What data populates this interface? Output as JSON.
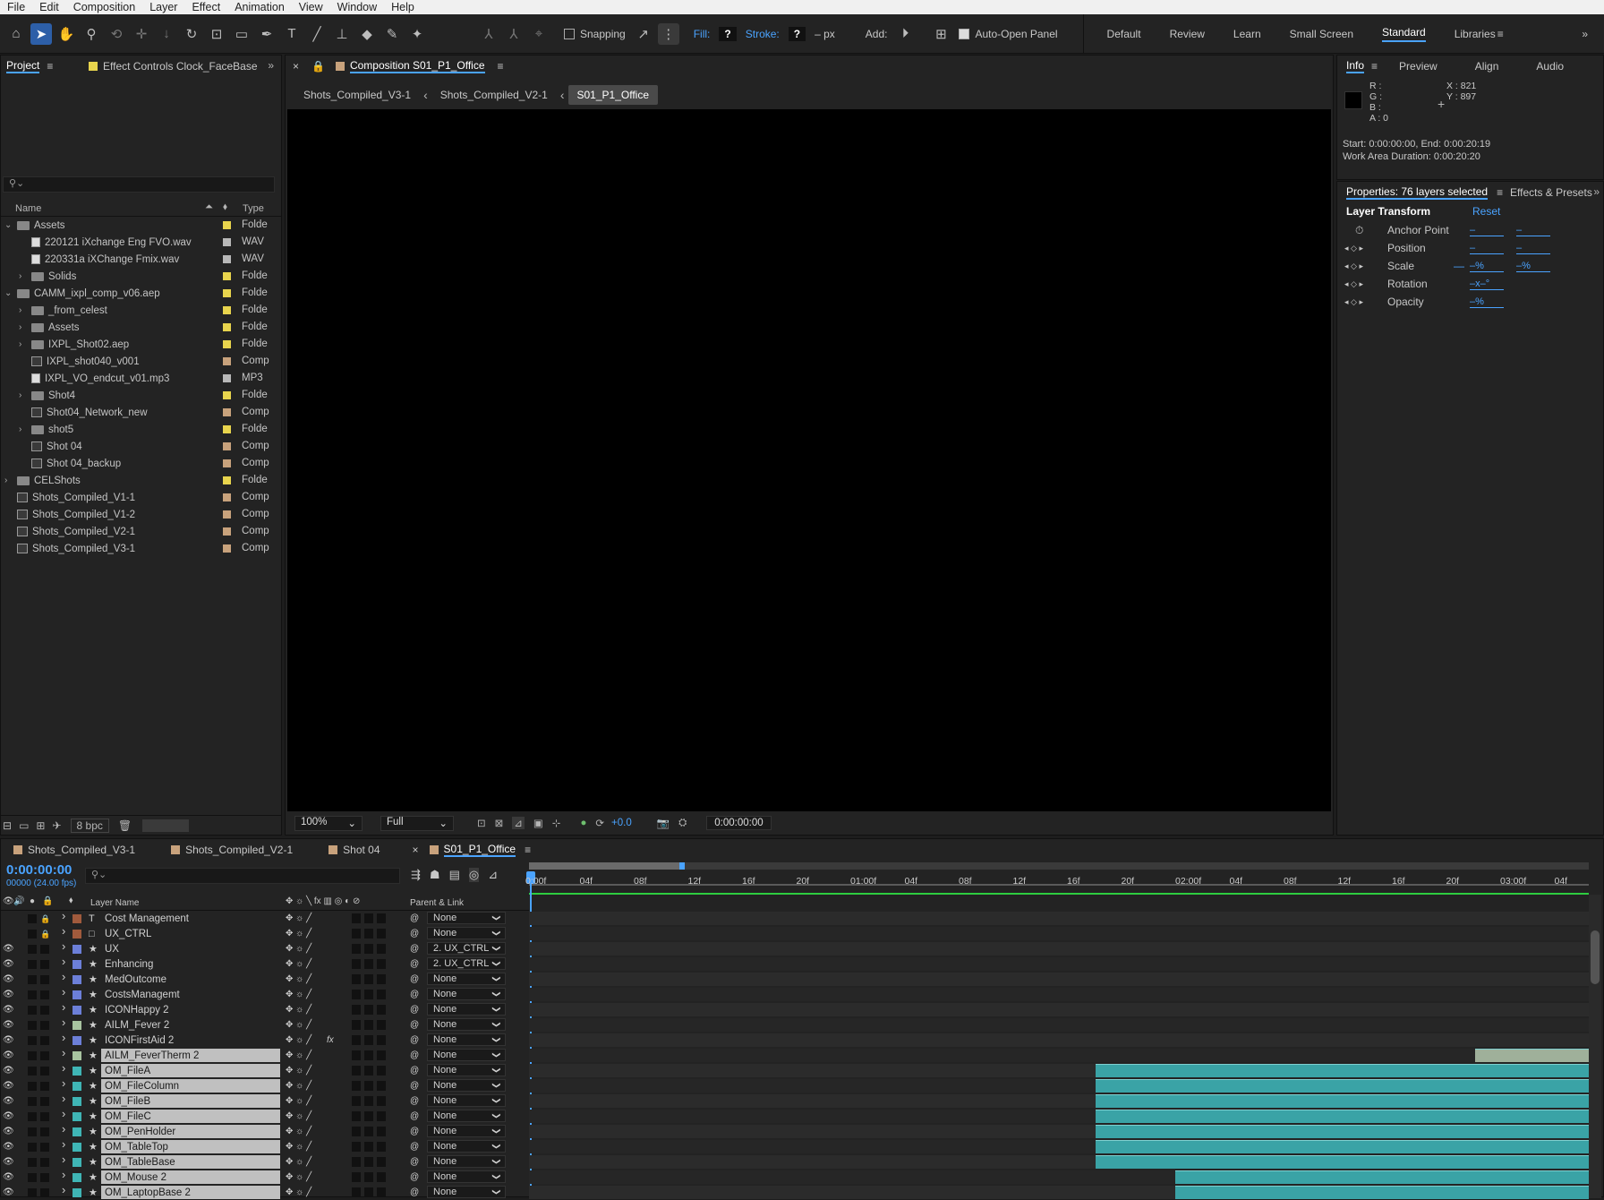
{
  "menu": [
    "File",
    "Edit",
    "Composition",
    "Layer",
    "Effect",
    "Animation",
    "View",
    "Window",
    "Help"
  ],
  "toolbar": {
    "snapping": "Snapping",
    "fill": "Fill:",
    "fill_value": "?",
    "stroke": "Stroke:",
    "stroke_value": "?",
    "stroke_px": "– px",
    "add": "Add:",
    "auto_open": "Auto-Open Panel"
  },
  "workspaces": [
    "Default",
    "Review",
    "Learn",
    "Small Screen",
    "Standard",
    "Libraries"
  ],
  "workspace_current": "Standard",
  "project": {
    "tab": "Project",
    "effect_tab": "Effect Controls Clock_FaceBase",
    "col_name": "Name",
    "col_type": "Type",
    "bpc": "8 bpc",
    "items": [
      {
        "name": "Assets",
        "type": "Folde",
        "kind": "folder",
        "indent": 0,
        "open": true,
        "color": "#e8d44d"
      },
      {
        "name": "220121 iXchange Eng FVO.wav",
        "type": "WAV",
        "kind": "audio",
        "indent": 1,
        "color": "#b8b8b8"
      },
      {
        "name": "220331a iXChange Fmix.wav",
        "type": "WAV",
        "kind": "audio",
        "indent": 1,
        "color": "#b8b8b8"
      },
      {
        "name": "Solids",
        "type": "Folde",
        "kind": "folder",
        "indent": 1,
        "closed": true,
        "color": "#e8d44d"
      },
      {
        "name": "CAMM_ixpl_comp_v06.aep",
        "type": "Folde",
        "kind": "folder",
        "indent": 0,
        "open": true,
        "color": "#e8d44d"
      },
      {
        "name": "_from_celest",
        "type": "Folde",
        "kind": "folder",
        "indent": 1,
        "closed": true,
        "color": "#e8d44d"
      },
      {
        "name": "Assets",
        "type": "Folde",
        "kind": "folder",
        "indent": 1,
        "closed": true,
        "color": "#e8d44d"
      },
      {
        "name": "IXPL_Shot02.aep",
        "type": "Folde",
        "kind": "folder",
        "indent": 1,
        "closed": true,
        "color": "#e8d44d"
      },
      {
        "name": "IXPL_shot040_v001",
        "type": "Comp",
        "kind": "comp",
        "indent": 1,
        "color": "#c8a27c"
      },
      {
        "name": "IXPL_VO_endcut_v01.mp3",
        "type": "MP3",
        "kind": "audio",
        "indent": 1,
        "color": "#b8b8b8"
      },
      {
        "name": "Shot4",
        "type": "Folde",
        "kind": "folder",
        "indent": 1,
        "closed": true,
        "color": "#e8d44d"
      },
      {
        "name": "Shot04_Network_new",
        "type": "Comp",
        "kind": "comp",
        "indent": 1,
        "color": "#c8a27c"
      },
      {
        "name": "shot5",
        "type": "Folde",
        "kind": "folder",
        "indent": 1,
        "closed": true,
        "color": "#e8d44d"
      },
      {
        "name": "Shot 04",
        "type": "Comp",
        "kind": "comp",
        "indent": 1,
        "color": "#c8a27c"
      },
      {
        "name": "Shot 04_backup",
        "type": "Comp",
        "kind": "comp",
        "indent": 1,
        "color": "#c8a27c"
      },
      {
        "name": "CELShots",
        "type": "Folde",
        "kind": "folder",
        "indent": 0,
        "closed": true,
        "color": "#e8d44d"
      },
      {
        "name": "Shots_Compiled_V1-1",
        "type": "Comp",
        "kind": "comp",
        "indent": 0,
        "color": "#c8a27c"
      },
      {
        "name": "Shots_Compiled_V1-2",
        "type": "Comp",
        "kind": "comp",
        "indent": 0,
        "color": "#c8a27c"
      },
      {
        "name": "Shots_Compiled_V2-1",
        "type": "Comp",
        "kind": "comp",
        "indent": 0,
        "color": "#c8a27c"
      },
      {
        "name": "Shots_Compiled_V3-1",
        "type": "Comp",
        "kind": "comp",
        "indent": 0,
        "color": "#c8a27c"
      }
    ]
  },
  "composition": {
    "tab": "Composition S01_P1_Office",
    "breadcrumbs": [
      "Shots_Compiled_V3-1",
      "Shots_Compiled_V2-1",
      "S01_P1_Office"
    ],
    "zoom": "100%",
    "resolution": "Full",
    "exposure": "+0.0",
    "timecode": "0:00:00:00"
  },
  "info": {
    "tabs": [
      "Info",
      "Preview",
      "Align",
      "Audio"
    ],
    "r": "R :",
    "g": "G :",
    "b": "B :",
    "a": "A :  0",
    "x": "X : 821",
    "y": "Y : 897",
    "start": "Start: 0:00:00:00, End: 0:00:20:19",
    "duration": "Work Area Duration: 0:00:20:20"
  },
  "properties": {
    "tab": "Properties: 76 layers selected",
    "effects_tab": "Effects & Presets",
    "section": "Layer Transform",
    "reset": "Reset",
    "rows": [
      {
        "label": "Anchor Point",
        "v1": "–",
        "v2": "–"
      },
      {
        "label": "Position",
        "v1": "–",
        "v2": "–"
      },
      {
        "label": "Scale",
        "v1": "–%",
        "v2": "–%"
      },
      {
        "label": "Rotation",
        "v1": "–x–°",
        "v2": ""
      },
      {
        "label": "Opacity",
        "v1": "–%",
        "v2": ""
      }
    ]
  },
  "timeline": {
    "tabs": [
      "Shots_Compiled_V3-1",
      "Shots_Compiled_V2-1",
      "Shot 04",
      "S01_P1_Office"
    ],
    "timecode": "0:00:00:00",
    "fps": "00000 (24.00 fps)",
    "col_layer": "Layer Name",
    "col_parent": "Parent & Link",
    "ticks": [
      "0:00f",
      "04f",
      "08f",
      "12f",
      "16f",
      "20f",
      "01:00f",
      "04f",
      "08f",
      "12f",
      "16f",
      "20f",
      "02:00f",
      "04f",
      "08f",
      "12f",
      "16f",
      "20f",
      "03:00f",
      "04f"
    ],
    "layers": [
      {
        "name": "Cost Management",
        "type": "T",
        "color": "#a05a3c",
        "parent": "None",
        "lock": true,
        "eye": false,
        "sel": false
      },
      {
        "name": "UX_CTRL",
        "type": "□",
        "color": "#a05a3c",
        "parent": "None",
        "lock": true,
        "eye": false,
        "sel": false
      },
      {
        "name": "UX",
        "type": "★",
        "color": "#6c7fd8",
        "parent": "2. UX_CTRL",
        "eye": true,
        "sel": false
      },
      {
        "name": "Enhancing",
        "type": "★",
        "color": "#6c7fd8",
        "parent": "2. UX_CTRL",
        "eye": true,
        "sel": false
      },
      {
        "name": "MedOutcome",
        "type": "★",
        "color": "#6c7fd8",
        "parent": "None",
        "eye": true,
        "sel": false
      },
      {
        "name": "CostsManagemt",
        "type": "★",
        "color": "#6c7fd8",
        "parent": "None",
        "eye": true,
        "sel": false
      },
      {
        "name": "ICONHappy 2",
        "type": "★",
        "color": "#6c7fd8",
        "parent": "None",
        "eye": true,
        "sel": false
      },
      {
        "name": "AILM_Fever 2",
        "type": "★",
        "color": "#a8c4a0",
        "parent": "None",
        "eye": true,
        "sel": false
      },
      {
        "name": "ICONFirstAid 2",
        "type": "★",
        "color": "#6c7fd8",
        "parent": "None",
        "eye": true,
        "sel": false,
        "fx": true
      },
      {
        "name": "AILM_FeverTherm 2",
        "type": "★",
        "color": "#a8c4a0",
        "parent": "None",
        "eye": true,
        "sel": true,
        "bar": [
          0.893,
          1.0
        ],
        "barColor": "#9fb09a"
      },
      {
        "name": "OM_FileA",
        "type": "★",
        "color": "#3fb5b5",
        "parent": "None",
        "eye": true,
        "sel": true,
        "bar": [
          0.535,
          1.0
        ],
        "barColor": "#3aa3a6"
      },
      {
        "name": "OM_FileColumn",
        "type": "★",
        "color": "#3fb5b5",
        "parent": "None",
        "eye": true,
        "sel": true,
        "bar": [
          0.535,
          1.0
        ],
        "barColor": "#3aa3a6"
      },
      {
        "name": "OM_FileB",
        "type": "★",
        "color": "#3fb5b5",
        "parent": "None",
        "eye": true,
        "sel": true,
        "bar": [
          0.535,
          1.0
        ],
        "barColor": "#3aa3a6"
      },
      {
        "name": "OM_FileC",
        "type": "★",
        "color": "#3fb5b5",
        "parent": "None",
        "eye": true,
        "sel": true,
        "bar": [
          0.535,
          1.0
        ],
        "barColor": "#3aa3a6"
      },
      {
        "name": "OM_PenHolder",
        "type": "★",
        "color": "#3fb5b5",
        "parent": "None",
        "eye": true,
        "sel": true,
        "bar": [
          0.535,
          1.0
        ],
        "barColor": "#3aa3a6"
      },
      {
        "name": "OM_TableTop",
        "type": "★",
        "color": "#3fb5b5",
        "parent": "None",
        "eye": true,
        "sel": true,
        "bar": [
          0.535,
          1.0
        ],
        "barColor": "#3aa3a6"
      },
      {
        "name": "OM_TableBase",
        "type": "★",
        "color": "#3fb5b5",
        "parent": "None",
        "eye": true,
        "sel": true,
        "bar": [
          0.535,
          1.0
        ],
        "barColor": "#3aa3a6"
      },
      {
        "name": "OM_Mouse 2",
        "type": "★",
        "color": "#3fb5b5",
        "parent": "None",
        "eye": true,
        "sel": true,
        "bar": [
          0.61,
          1.0
        ],
        "barColor": "#3aa3a6"
      },
      {
        "name": "OM_LaptopBase 2",
        "type": "★",
        "color": "#3fb5b5",
        "parent": "None",
        "eye": true,
        "sel": true,
        "bar": [
          0.61,
          1.0
        ],
        "barColor": "#3aa3a6"
      }
    ]
  }
}
